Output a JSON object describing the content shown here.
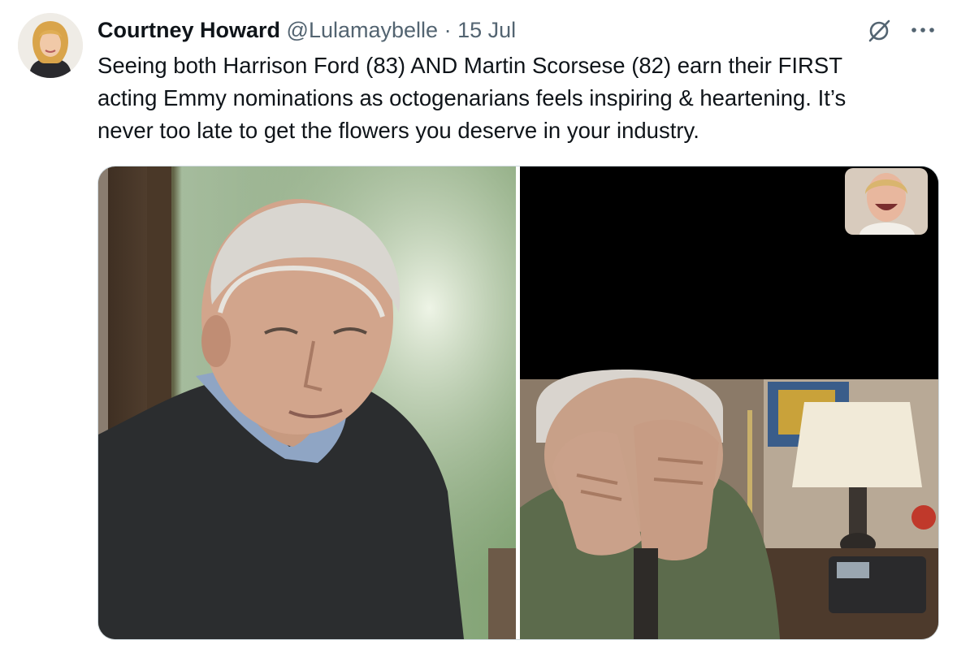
{
  "tweet": {
    "author": {
      "display_name": "Courtney Howard",
      "handle": "@Lulamaybelle",
      "avatar_icon": "profile-photo"
    },
    "separator": "·",
    "date": "15 Jul",
    "text_lines": [
      "Seeing both Harrison Ford (83) AND Martin Scorsese (82) earn their FIRST",
      "acting Emmy nominations as octogenarians feels inspiring & heartening. It’s",
      "never too late to get the flowers you deserve in your industry."
    ],
    "actions": {
      "grok_icon": "grok-slash-circle-icon",
      "more_icon": "more-horizontal-icon"
    },
    "media": [
      {
        "kind": "photo",
        "icon": "photo-elderly-man-dark-sweater"
      },
      {
        "kind": "photo",
        "icon": "photo-video-call-man-covering-face"
      }
    ]
  },
  "colors": {
    "text_primary": "#0f1419",
    "text_secondary": "#536471",
    "media_border": "#cfd9de"
  }
}
